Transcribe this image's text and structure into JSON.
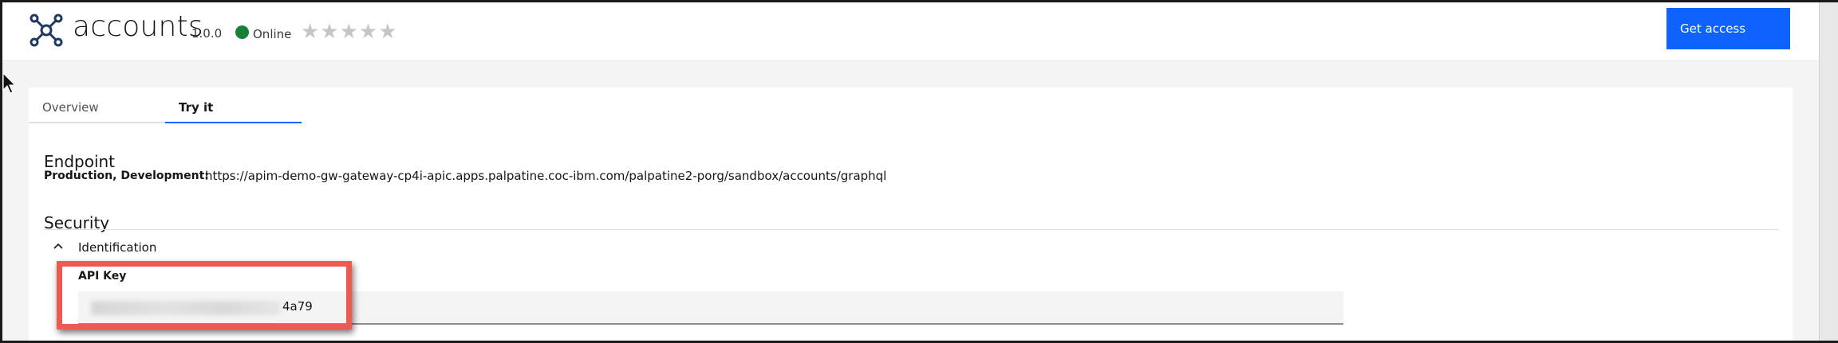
{
  "header": {
    "title": "accounts",
    "version": "1.0.0",
    "status": "Online",
    "status_color": "#198038",
    "rating_stars": "★★★★★",
    "rating_value": 0,
    "get_access_label": "Get access",
    "logo_icon": "api-network-icon",
    "accent_color": "#0f62fe"
  },
  "tabs": [
    {
      "label": "Overview",
      "active": false
    },
    {
      "label": "Try it",
      "active": true
    }
  ],
  "endpoint": {
    "title": "Endpoint",
    "environments": "Production, Development:",
    "url": "https://apim-demo-gw-gateway-cp4i-apic.apps.palpatine.coc-ibm.com/palpatine2-porg/sandbox/accounts/graphql"
  },
  "security": {
    "title": "Security",
    "section_label": "Identification",
    "section_icon": "chevron-up-icon",
    "api_key_label": "API Key",
    "api_key_visible_suffix": "4a79"
  }
}
